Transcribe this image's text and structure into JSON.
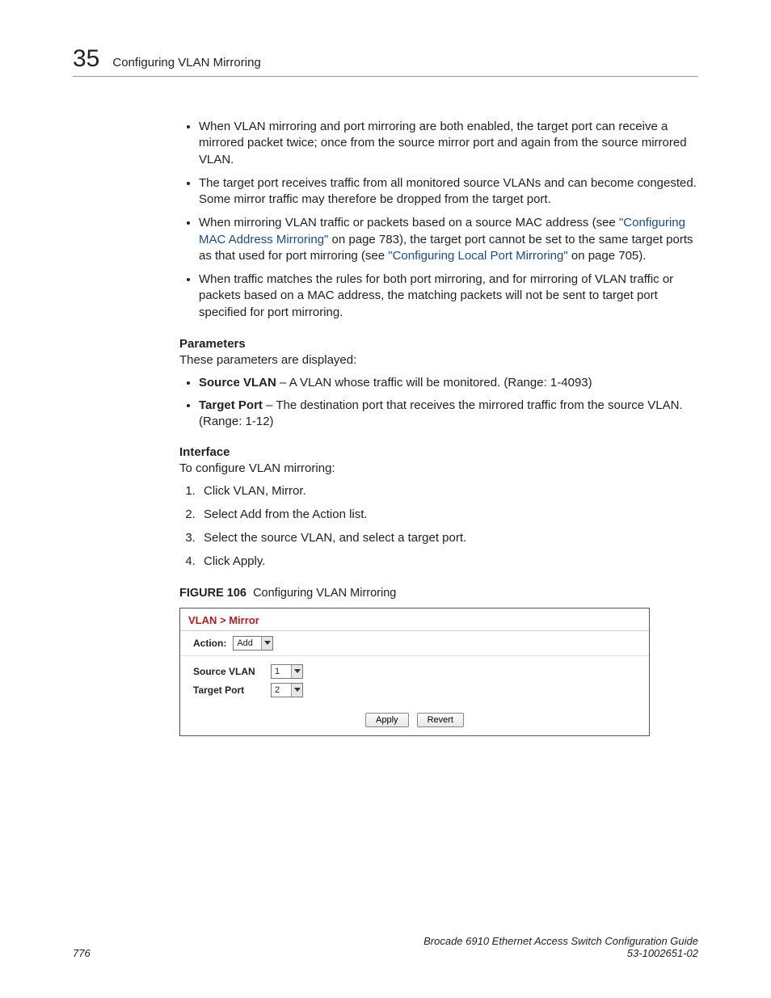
{
  "header": {
    "chapter": "35",
    "title": "Configuring VLAN Mirroring"
  },
  "bullets": [
    "When VLAN mirroring and port mirroring are both enabled, the target port can receive a mirrored packet twice; once from the source mirror port and again from the source mirrored VLAN.",
    "The target port receives traffic from all monitored source VLANs and can become congested. Some mirror traffic may therefore be dropped from the target port.",
    {
      "pre": "When mirroring VLAN traffic or packets based on a source MAC address (see ",
      "link1": "\"Configuring MAC Address Mirroring\"",
      "mid1": " on page 783), the target port cannot be set to the same target ports as that used for port mirroring (see ",
      "link2": "\"Configuring Local Port Mirroring\"",
      "post": " on page 705)."
    },
    "When traffic matches the rules for both port mirroring, and for mirroring of VLAN traffic or packets based on a MAC address, the matching packets will not be sent to target port specified for port mirroring."
  ],
  "parameters": {
    "heading": "Parameters",
    "intro": "These parameters are displayed:",
    "items": [
      {
        "name": "Source VLAN",
        "desc": " – A VLAN whose traffic will be monitored. (Range: 1-4093)"
      },
      {
        "name": "Target Port",
        "desc": " – The destination port that receives the mirrored traffic from the source VLAN. (Range: 1-12)"
      }
    ]
  },
  "interface": {
    "heading": "Interface",
    "intro": "To configure VLAN mirroring:",
    "steps": [
      "Click VLAN, Mirror.",
      "Select Add from the Action list.",
      "Select the source VLAN, and select a target port.",
      "Click Apply."
    ]
  },
  "figure": {
    "label": "FIGURE 106",
    "caption": "Configuring VLAN Mirroring",
    "panel": {
      "breadcrumb": "VLAN > Mirror",
      "action_label": "Action:",
      "action_value": "Add",
      "rows": [
        {
          "label": "Source VLAN",
          "value": "1"
        },
        {
          "label": "Target Port",
          "value": "2"
        }
      ],
      "apply": "Apply",
      "revert": "Revert"
    }
  },
  "footer": {
    "page": "776",
    "book": "Brocade 6910 Ethernet Access Switch Configuration Guide",
    "docnum": "53-1002651-02"
  }
}
